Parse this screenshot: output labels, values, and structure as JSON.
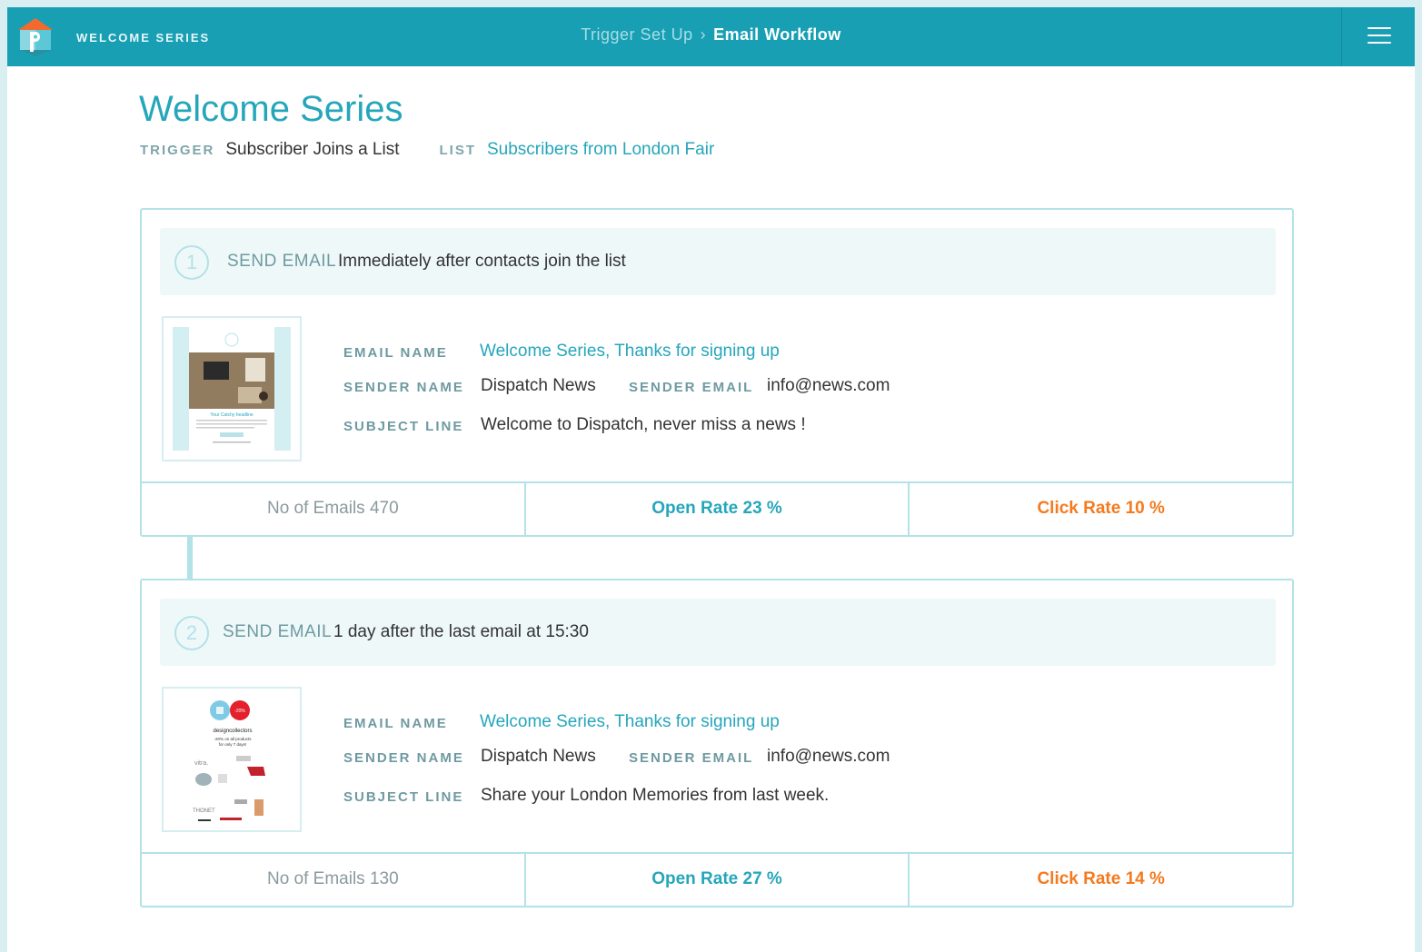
{
  "app": {
    "brand": "WELCOME SERIES",
    "breadcrumb": [
      "Trigger Set Up",
      "Email Workflow"
    ],
    "breadcrumb_sep": "›",
    "menu_icon": "hamburger-menu-icon",
    "colors": {
      "topbar": "#189fb4",
      "accent": "#25a6bb",
      "click_rate": "#f47a1f"
    }
  },
  "page": {
    "title": "Welcome Series",
    "trigger_label": "TRIGGER",
    "trigger_value": "Subscriber Joins a List",
    "list_label": "LIST",
    "list_value": "Subscribers from London Fair"
  },
  "labels": {
    "send_email": "SEND EMAIL",
    "email_name": "EMAIL NAME",
    "sender_name": "SENDER NAME",
    "sender_email": "SENDER EMAIL",
    "subject_line": "SUBJECT LINE"
  },
  "steps": [
    {
      "number": "1",
      "timing": "Immediately after contacts join the list",
      "email_name": "Welcome Series, Thanks for signing up",
      "sender_name": "Dispatch News",
      "sender_email": "info@news.com",
      "subject_line": "Welcome to Dispatch, never miss a news !",
      "thumb_headline": "Your Catchy headline",
      "no_of_emails": "No of Emails 470",
      "open_rate": "Open Rate 23 %",
      "click_rate": "Click Rate 10 %"
    },
    {
      "number": "2",
      "timing": "1 day after the last email at 15:30",
      "email_name": "Welcome Series, Thanks for signing up",
      "sender_name": "Dispatch News",
      "sender_email": "info@news.com",
      "subject_line": "Share your London Memories from last week.",
      "thumb_badge": "-20%",
      "thumb_brand": "designcollectors",
      "thumb_promo_1": "-20% on all products",
      "thumb_promo_2": "for only 7 days!",
      "thumb_vitra": "vitra.",
      "thumb_thonet": "THONET",
      "no_of_emails": "No of Emails 130",
      "open_rate": "Open Rate 27 %",
      "click_rate": "Click Rate 14 %"
    }
  ]
}
